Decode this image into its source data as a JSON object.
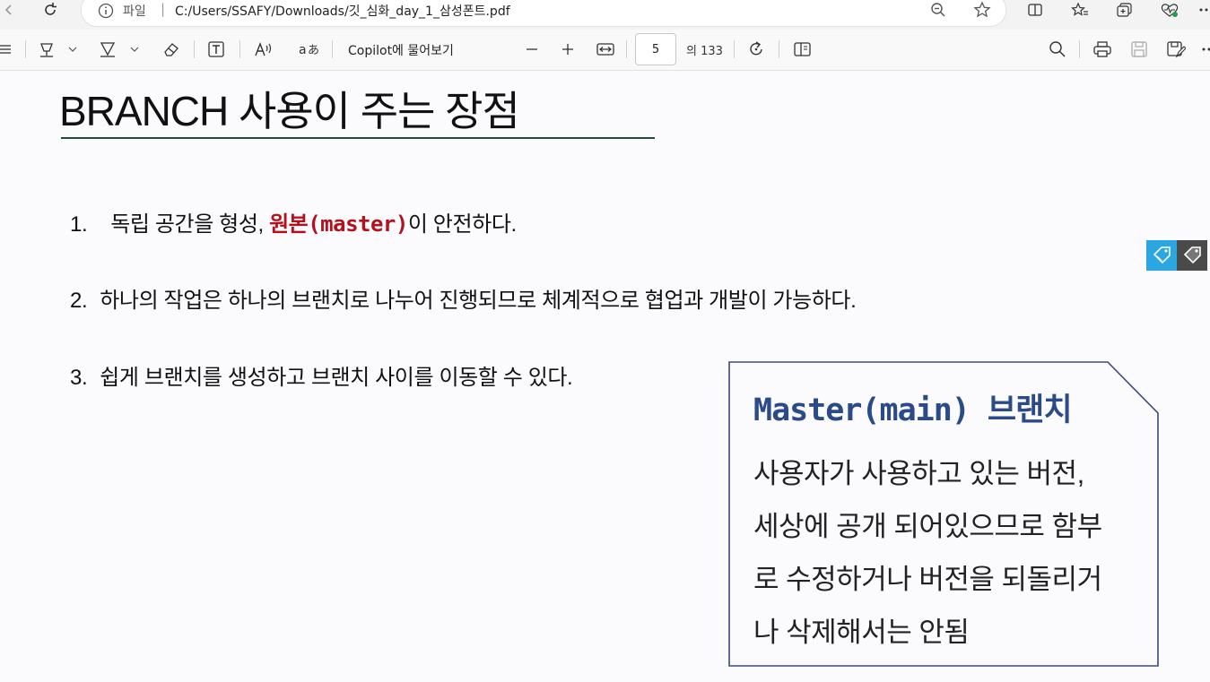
{
  "browser": {
    "address_label": "파일",
    "url": "C:/Users/SSAFY/Downloads/깃_심화_day_1_삼성폰트.pdf",
    "icons": [
      "back-icon",
      "refresh-icon",
      "info-icon",
      "zoom-out-icon",
      "favorite-star-icon",
      "split-screen-icon",
      "favorites-icon",
      "collections-icon",
      "browser-essentials-icon"
    ]
  },
  "pdf_toolbar": {
    "copilot_label": "Copilot에 물어보기",
    "current_page": "5",
    "page_total_label": "의 133",
    "icons": [
      "contents-icon",
      "highlight-icon",
      "draw-icon",
      "erase-icon",
      "text-icon",
      "read-aloud-icon",
      "translate-icon",
      "zoom-out-icon",
      "zoom-in-icon",
      "fit-width-icon",
      "rotate-icon",
      "page-view-icon",
      "search-icon",
      "print-icon",
      "save-icon",
      "save-as-icon",
      "more-icon"
    ]
  },
  "slide": {
    "title": "BRANCH 사용이 주는 장점",
    "items": [
      {
        "num": "1.",
        "pre": "독립 공간을 형성, ",
        "highlight": "원본(master)",
        "post": "이 안전하다."
      },
      {
        "num": "2.",
        "text": "하나의 작업은 하나의 브랜치로 나누어 진행되므로 체계적으로 협업과 개발이 가능하다."
      },
      {
        "num": "3.",
        "text": "쉽게 브랜치를 생성하고 브랜치 사이를 이동할 수 있다."
      }
    ],
    "callout": {
      "heading": "Master(main) 브랜치",
      "lines": [
        "사용자가 사용하고 있는 버전,",
        "세상에 공개 되어있으므로 함부",
        "로 수정하거나 버전을 되돌리거",
        "나 삭제해서는 안됨"
      ]
    }
  },
  "colors": {
    "highlight_red": "#b3121c",
    "callout_heading": "#2b4a8a",
    "title_rule": "#244c35",
    "badge_blue": "#2aa7e0",
    "badge_gray": "#4a4a4a"
  }
}
